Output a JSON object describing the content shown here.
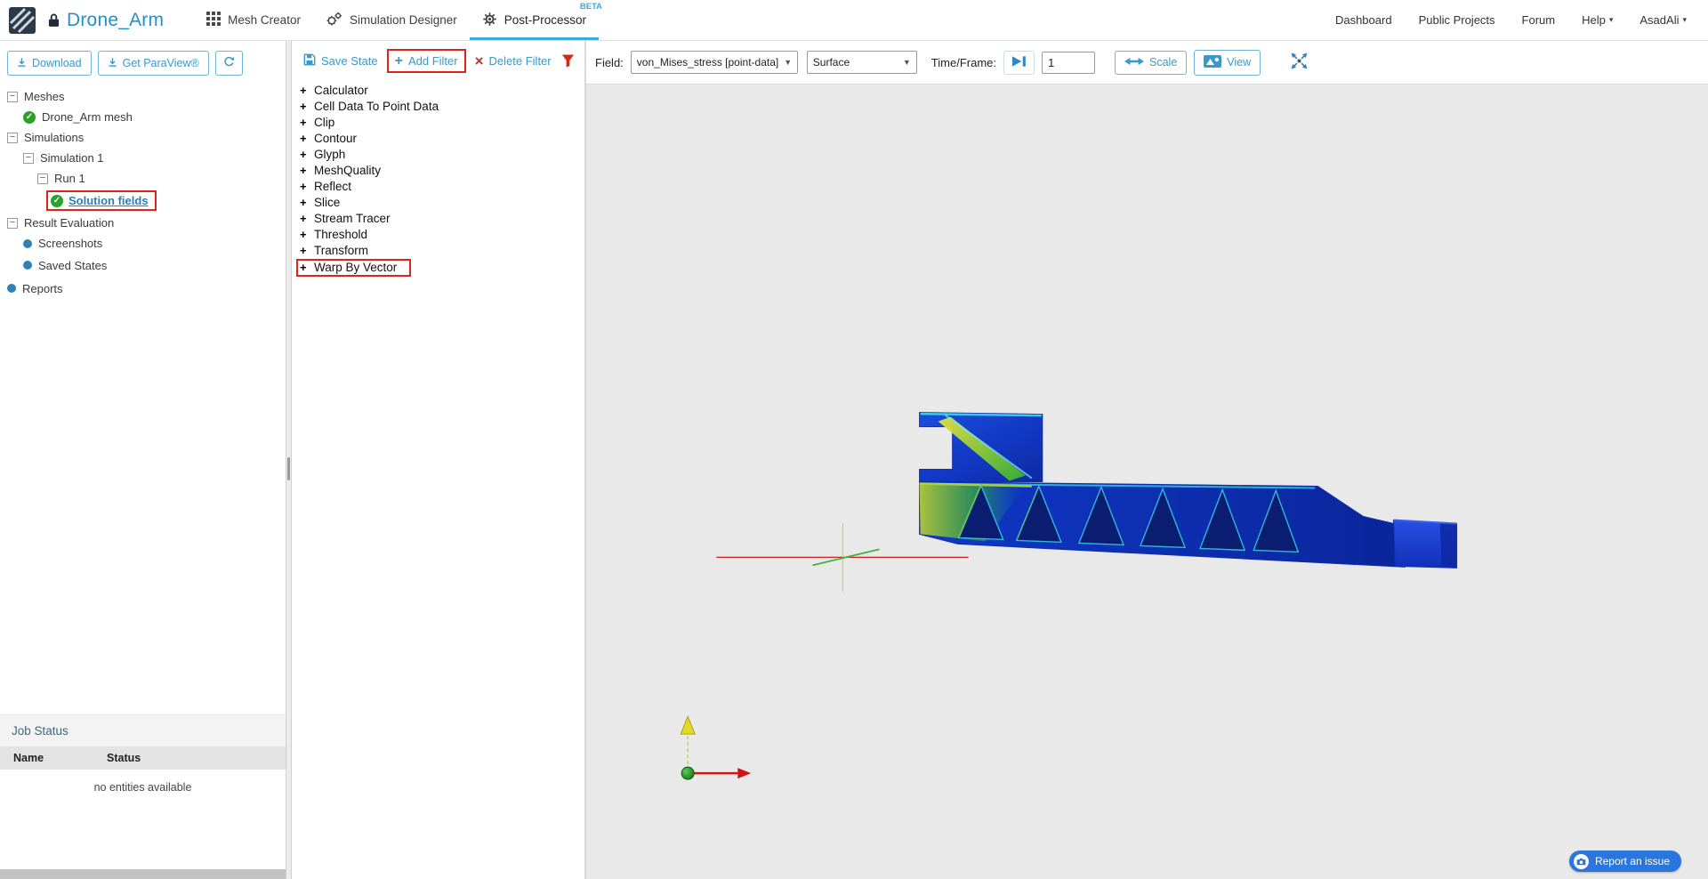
{
  "navbar": {
    "title": "Drone_Arm",
    "tabs": [
      {
        "label": "Mesh Creator"
      },
      {
        "label": "Simulation Designer"
      },
      {
        "label": "Post-Processor",
        "badge": "BETA"
      }
    ],
    "links": {
      "dashboard": "Dashboard",
      "public_projects": "Public Projects",
      "forum": "Forum",
      "help": "Help",
      "user": "AsadAli"
    }
  },
  "left_panel": {
    "toolbar": {
      "download": "Download",
      "paraview": "Get ParaView®"
    },
    "tree": {
      "meshes": "Meshes",
      "drone_arm_mesh": "Drone_Arm mesh",
      "simulations": "Simulations",
      "simulation_1": "Simulation 1",
      "run_1": "Run 1",
      "solution_fields": "Solution fields",
      "result_evaluation": "Result Evaluation",
      "screenshots": "Screenshots",
      "saved_states": "Saved States",
      "reports": "Reports"
    },
    "job_status": {
      "title": "Job Status",
      "col_name": "Name",
      "col_status": "Status",
      "empty": "no entities available"
    }
  },
  "filter_panel": {
    "save_state": "Save State",
    "add_filter": "Add Filter",
    "delete_filter": "Delete Filter",
    "filters": [
      "Calculator",
      "Cell Data To Point Data",
      "Clip",
      "Contour",
      "Glyph",
      "MeshQuality",
      "Reflect",
      "Slice",
      "Stream Tracer",
      "Threshold",
      "Transform",
      "Warp By Vector"
    ]
  },
  "viewer": {
    "field_label": "Field:",
    "field_value": "von_Mises_stress [point-data]",
    "representation": "Surface",
    "time_label": "Time/Frame:",
    "time_value": "1",
    "scale_label": "Scale",
    "view_label": "View",
    "report_issue": "Report an issue"
  },
  "colors": {
    "accent": "#3a99c9",
    "annotation_red": "#e0241c",
    "viewport_bg": "#e9e9e9"
  }
}
